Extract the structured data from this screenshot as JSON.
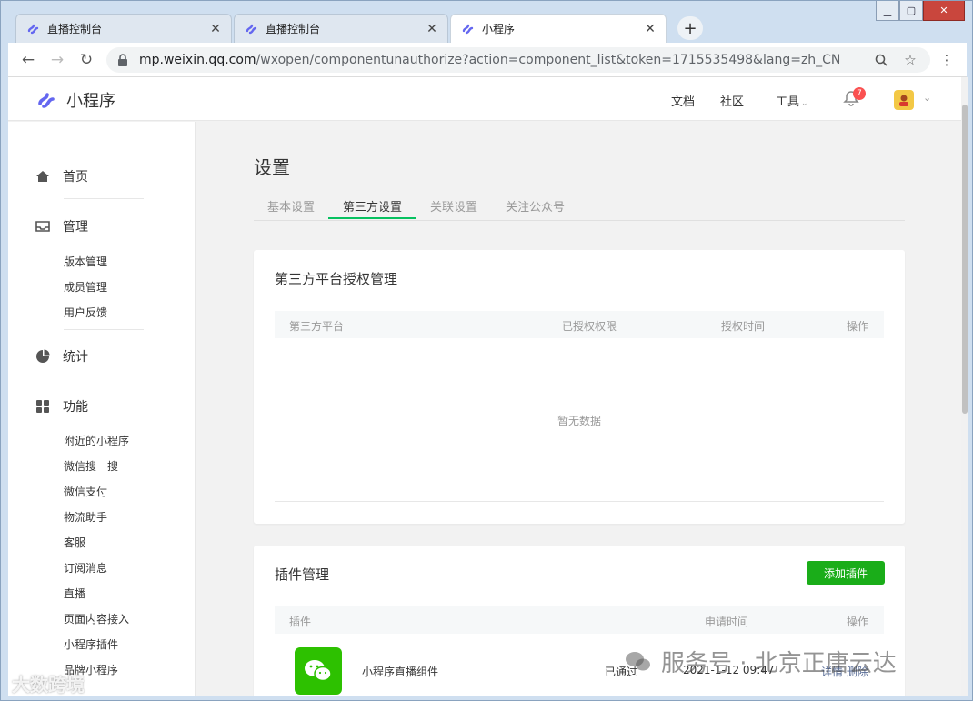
{
  "browser": {
    "tabs": [
      {
        "title": "直播控制台"
      },
      {
        "title": "直播控制台"
      },
      {
        "title": "小程序"
      }
    ],
    "new_tab": "+",
    "url_host": "mp.weixin.qq.com",
    "url_path": "/wxopen/componentunauthorize?action=component_list&token=1715535498&lang=zh_CN"
  },
  "header": {
    "brand": "小程序",
    "links": [
      "文档",
      "社区",
      "工具"
    ],
    "notification_count": "7"
  },
  "sidebar": {
    "home": "首页",
    "manage": {
      "label": "管理",
      "items": [
        "版本管理",
        "成员管理",
        "用户反馈"
      ]
    },
    "stats": "统计",
    "features": {
      "label": "功能",
      "items": [
        "附近的小程序",
        "微信搜一搜",
        "微信支付",
        "物流助手",
        "客服",
        "订阅消息",
        "直播",
        "页面内容接入",
        "小程序插件",
        "品牌小程序"
      ]
    }
  },
  "main": {
    "title": "设置",
    "tabs": [
      "基本设置",
      "第三方设置",
      "关联设置",
      "关注公众号"
    ],
    "active_tab": 1,
    "third_party": {
      "title": "第三方平台授权管理",
      "columns": [
        "第三方平台",
        "已授权权限",
        "授权时间",
        "操作"
      ],
      "empty_text": "暂无数据"
    },
    "plugins": {
      "title": "插件管理",
      "add_button": "添加插件",
      "columns": [
        "插件",
        "申请时间",
        "操作"
      ],
      "rows": [
        {
          "name": "小程序直播组件",
          "status": "已通过",
          "time": "2021-1-12 09:47",
          "actions": "详情 删除"
        }
      ]
    }
  },
  "watermark": {
    "text": "服务号 · 北京正唐云达",
    "corner": "大数跨境"
  },
  "colors": {
    "accent_green": "#07c160",
    "button_green": "#1aad19",
    "badge_red": "#fa5151"
  }
}
